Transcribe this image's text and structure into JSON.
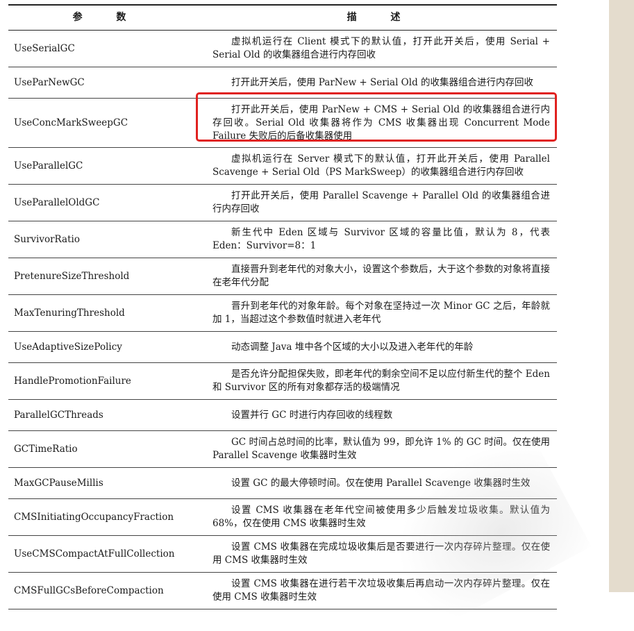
{
  "table": {
    "header": {
      "param": "参 数",
      "desc": "描 述"
    },
    "rows": [
      {
        "name": "UseSerialGC",
        "desc": "虚拟机运行在 Client 模式下的默认值，打开此开关后，使用 Serial + Serial Old 的收集器组合进行内存回收"
      },
      {
        "name": "UseParNewGC",
        "desc": "打开此开关后，使用 ParNew + Serial Old 的收集器组合进行内存回收"
      },
      {
        "name": "UseConcMarkSweepGC",
        "desc": "打开此开关后，使用 ParNew + CMS + Serial Old 的收集器组合进行内存回收。Serial Old 收集器将作为 CMS 收集器出现 Concurrent Mode Failure 失败后的后备收集器使用"
      },
      {
        "name": "UseParallelGC",
        "desc": "虚拟机运行在 Server 模式下的默认值，打开此开关后，使用 Parallel Scavenge + Serial Old（PS MarkSweep）的收集器组合进行内存回收"
      },
      {
        "name": "UseParallelOldGC",
        "desc": "打开此开关后，使用 Parallel Scavenge + Parallel Old 的收集器组合进行内存回收"
      },
      {
        "name": "SurvivorRatio",
        "desc": "新生代中 Eden 区域与 Survivor 区域的容量比值，默认为 8，代表 Eden：Survivor=8：1"
      },
      {
        "name": "PretenureSizeThreshold",
        "desc": "直接晋升到老年代的对象大小，设置这个参数后，大于这个参数的对象将直接在老年代分配"
      },
      {
        "name": "MaxTenuringThreshold",
        "desc": "晋升到老年代的对象年龄。每个对象在坚持过一次 Minor GC 之后，年龄就加 1，当超过这个参数值时就进入老年代"
      },
      {
        "name": "UseAdaptiveSizePolicy",
        "desc": "动态调整 Java 堆中各个区域的大小以及进入老年代的年龄"
      },
      {
        "name": "HandlePromotionFailure",
        "desc": "是否允许分配担保失败，即老年代的剩余空间不足以应付新生代的整个 Eden 和 Survivor 区的所有对象都存活的极端情况"
      },
      {
        "name": "ParallelGCThreads",
        "desc": "设置并行 GC 时进行内存回收的线程数"
      },
      {
        "name": "GCTimeRatio",
        "desc": "GC 时间占总时间的比率，默认值为 99，即允许 1% 的 GC 时间。仅在使用 Parallel Scavenge 收集器时生效"
      },
      {
        "name": "MaxGCPauseMillis",
        "desc": "设置 GC 的最大停顿时间。仅在使用 Parallel Scavenge 收集器时生效"
      },
      {
        "name": "CMSInitiatingOccupancyFraction",
        "desc": "设置 CMS 收集器在老年代空间被使用多少后触发垃圾收集。默认值为 68%，仅在使用 CMS 收集器时生效"
      },
      {
        "name": "UseCMSCompactAtFullCollection",
        "desc": "设置 CMS 收集器在完成垃圾收集后是否要进行一次内存碎片整理。仅在使用 CMS 收集器时生效"
      },
      {
        "name": "CMSFullGCsBeforeCompaction",
        "desc": "设置 CMS 收集器在进行若干次垃圾收集后再启动一次内存碎片整理。仅在使用 CMS 收集器时生效"
      }
    ]
  },
  "highlight_color": "#e0211f"
}
